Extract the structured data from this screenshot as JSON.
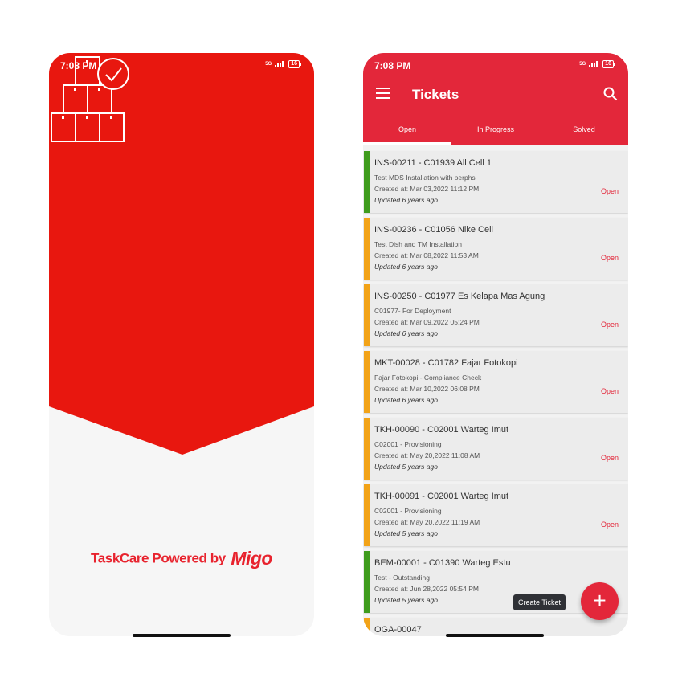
{
  "status_bar": {
    "time": "7:08 PM",
    "network": "5G",
    "battery": "16"
  },
  "splash": {
    "brand_text": "TaskCare Powered by",
    "brand_logo": "Migo",
    "logo_icon": "boxes-checkmark-icon",
    "colors": {
      "primary": "#e8170f",
      "background": "#f6f6f6"
    }
  },
  "tickets_screen": {
    "title": "Tickets",
    "menu_icon": "hamburger-menu-icon",
    "search_icon": "search-icon",
    "tabs": [
      {
        "label": "Open",
        "active": true
      },
      {
        "label": "In Progress",
        "active": false
      },
      {
        "label": "Solved",
        "active": false
      }
    ],
    "tickets": [
      {
        "title": "INS-00211 - C01939 All Cell 1",
        "description": "Test  MDS Installation with perphs",
        "created": "Created at: Mar 03,2022 11:12 PM",
        "updated": "Updated 6 years ago",
        "status": "Open",
        "accent": "green"
      },
      {
        "title": "INS-00236 - C01056 Nike Cell",
        "description": "Test Dish and TM Installation",
        "created": "Created at: Mar 08,2022 11:53 AM",
        "updated": "Updated 6 years ago",
        "status": "Open",
        "accent": "orange"
      },
      {
        "title": "INS-00250 - C01977 Es Kelapa Mas Agung",
        "description": "C01977- For Deployment",
        "created": "Created at: Mar 09,2022 05:24 PM",
        "updated": "Updated 6 years ago",
        "status": "Open",
        "accent": "orange"
      },
      {
        "title": "MKT-00028 - C01782 Fajar Fotokopi",
        "description": "Fajar Fotokopi - Compliance Check",
        "created": "Created at: Mar 10,2022 06:08 PM",
        "updated": "Updated 6 years ago",
        "status": "Open",
        "accent": "orange"
      },
      {
        "title": "TKH-00090 - C02001 Warteg Imut",
        "description": "C02001 - Provisioning",
        "created": "Created at: May 20,2022 11:08 AM",
        "updated": "Updated 5 years ago",
        "status": "Open",
        "accent": "orange"
      },
      {
        "title": "TKH-00091 - C02001 Warteg Imut",
        "description": "C02001 - Provisioning",
        "created": "Created at: May 20,2022 11:19 AM",
        "updated": "Updated 5 years ago",
        "status": "Open",
        "accent": "orange"
      },
      {
        "title": "BEM-00001 - C01390 Warteg Estu",
        "description": "Test -  Outstanding",
        "created": "Created at: Jun 28,2022 05:54 PM",
        "updated": "Updated 5 years ago",
        "status": "",
        "accent": "green"
      },
      {
        "title": "OGA-00047",
        "description": "",
        "created": "",
        "updated": "",
        "status": "",
        "accent": "orange"
      }
    ],
    "fab": {
      "label": "+",
      "tooltip": "Create Ticket"
    },
    "colors": {
      "primary": "#e3273a",
      "open_accent": "#4caf2a",
      "pending_accent": "#f2a318"
    }
  }
}
